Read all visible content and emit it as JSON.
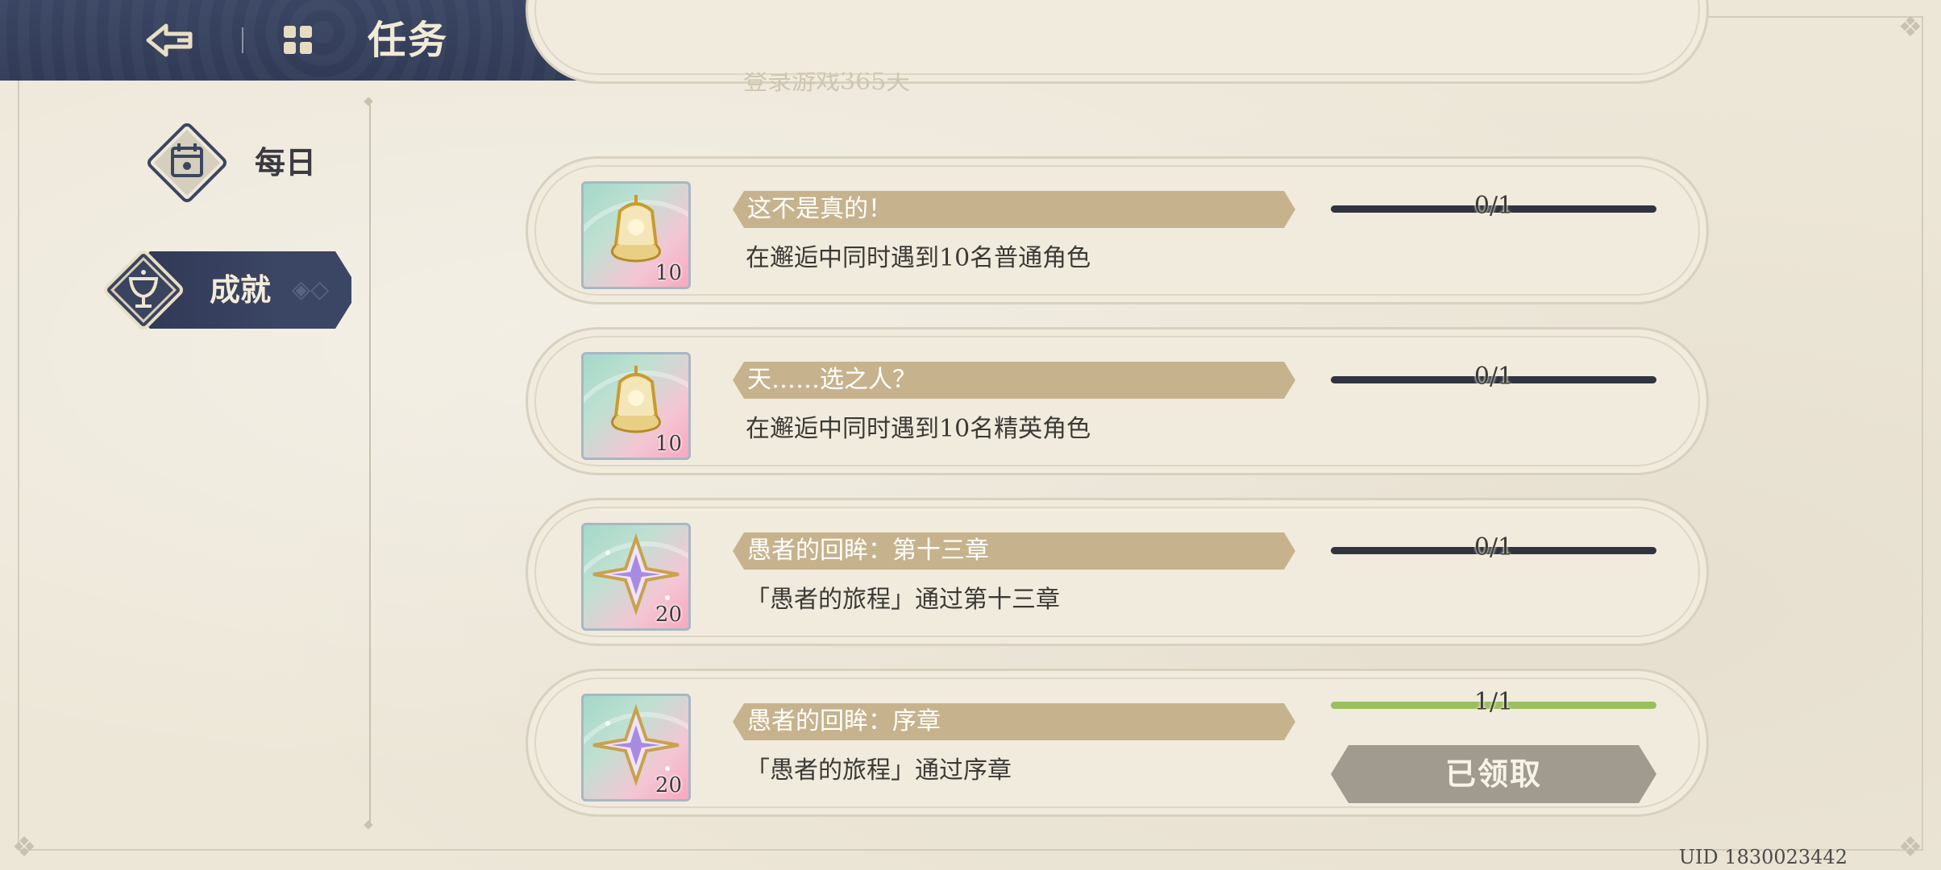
{
  "header": {
    "title": "任务",
    "back_icon": "back-arrow-icon",
    "menu_icon": "grid-menu-icon"
  },
  "sidebar": {
    "items": [
      {
        "label": "每日",
        "icon": "calendar-icon",
        "selected": false
      },
      {
        "label": "成就",
        "icon": "trophy-cup-icon",
        "selected": true
      }
    ]
  },
  "top_partial_task": {
    "description": "登录游戏365天"
  },
  "tasks": [
    {
      "title": "这不是真的！",
      "description": "在邂逅中同时遇到10名普通角色",
      "reward_icon": "lantern-icon",
      "reward_count": "10",
      "progress_text": "0/1",
      "progress": 0
    },
    {
      "title": "天……选之人？",
      "description": "在邂逅中同时遇到10名精英角色",
      "reward_icon": "lantern-icon",
      "reward_count": "10",
      "progress_text": "0/1",
      "progress": 0
    },
    {
      "title": "愚者的回眸：第十三章",
      "description": "「愚者的旅程」通过第十三章",
      "reward_icon": "star-crystal-icon",
      "reward_count": "20",
      "progress_text": "0/1",
      "progress": 0
    },
    {
      "title": "愚者的回眸：序章",
      "description": "「愚者的旅程」通过序章",
      "reward_icon": "star-crystal-icon",
      "reward_count": "20",
      "progress_text": "1/1",
      "progress": 1,
      "button_label": "已领取"
    }
  ],
  "footer": {
    "uid": "UID 1830023442"
  },
  "colors": {
    "header_bg": "#313b57",
    "title_bar": "#c6b38d",
    "progress_track": "#2f3440",
    "progress_fill": "#9cbf5e",
    "claimed_button": "#a09b8e",
    "page_bg": "#ede7d8"
  }
}
